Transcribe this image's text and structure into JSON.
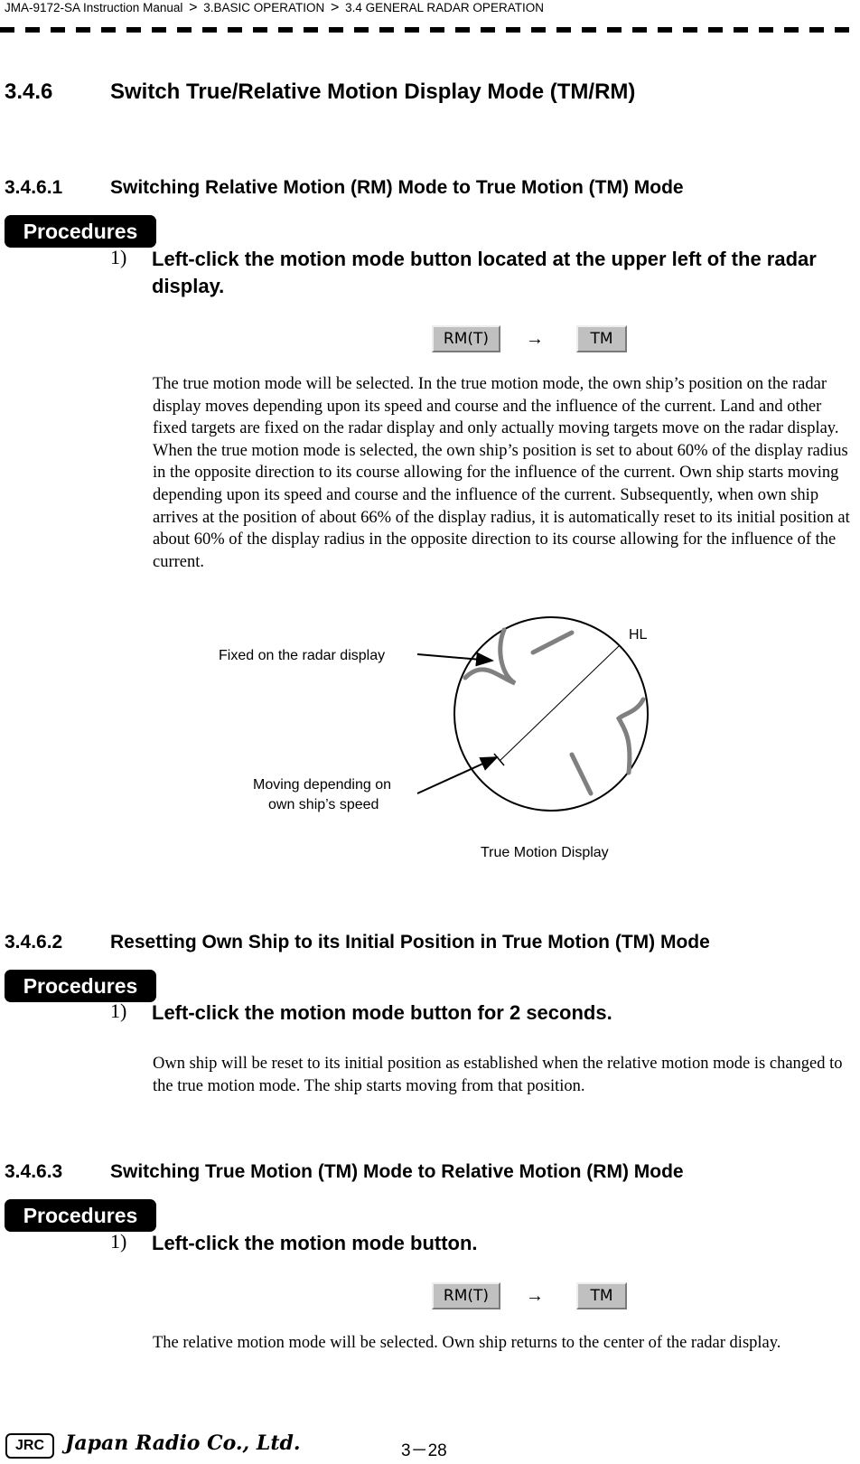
{
  "breadcrumb": {
    "items": [
      "JMA-9172-SA Instruction Manual",
      "3.BASIC OPERATION",
      "3.4  GENERAL RADAR OPERATION"
    ],
    "separator": ">"
  },
  "section": {
    "number": "3.4.6",
    "title": "Switch True/Relative Motion Display Mode (TM/RM)"
  },
  "subsections": [
    {
      "number": "3.4.6.1",
      "title": "Switching Relative Motion (RM) Mode to True Motion (TM) Mode",
      "procedures_label": "Procedures",
      "step_number": "1)",
      "step_text": "Left-click the motion mode button located at the upper left of the radar display.",
      "buttons": {
        "from": "RM(T)",
        "arrow": "→",
        "to": "TM"
      },
      "paragraph": "The true motion mode will be selected. In the true motion mode, the own ship’s position on the radar display moves depending upon its speed and course and the influence of the current. Land and other fixed targets are fixed on the radar display and only actually moving targets move on the radar display. When the true motion mode is selected, the own ship’s position is set to about 60% of the display radius in the opposite direction to its course allowing for the influence of the current. Own ship starts moving depending upon its speed and course and the influence of the current. Subsequently, when own ship arrives at the position of about 66% of the display radius, it is automatically reset to its initial position at about 60% of the display radius in the opposite direction to its course allowing for the influence of the current."
    },
    {
      "number": "3.4.6.2",
      "title": "Resetting Own Ship to its Initial Position in True Motion (TM) Mode",
      "procedures_label": "Procedures",
      "step_number": "1)",
      "step_text": "Left-click the motion mode button for 2 seconds.",
      "paragraph": "Own ship will be reset to its initial position as established when the relative motion mode is changed to the true motion mode. The ship starts moving from that position."
    },
    {
      "number": "3.4.6.3",
      "title": "Switching True Motion (TM) Mode to Relative Motion (RM) Mode",
      "procedures_label": "Procedures",
      "step_number": "1)",
      "step_text": "Left-click the motion mode button.",
      "buttons": {
        "from": "RM(T)",
        "arrow": "→",
        "to": "TM"
      },
      "paragraph": "The relative motion mode will be selected. Own ship returns to the center of the radar display."
    }
  ],
  "figure": {
    "label_fixed": "Fixed on the radar display",
    "label_moving_1": "Moving depending on",
    "label_moving_2": "own ship’s speed",
    "label_hl": "HL",
    "caption": "True Motion Display",
    "colors": {
      "target": "#808080",
      "line": "#000000"
    }
  },
  "footer": {
    "logo": "JRC",
    "brand": "Japan Radio Co., Ltd.",
    "page": "3－28"
  }
}
